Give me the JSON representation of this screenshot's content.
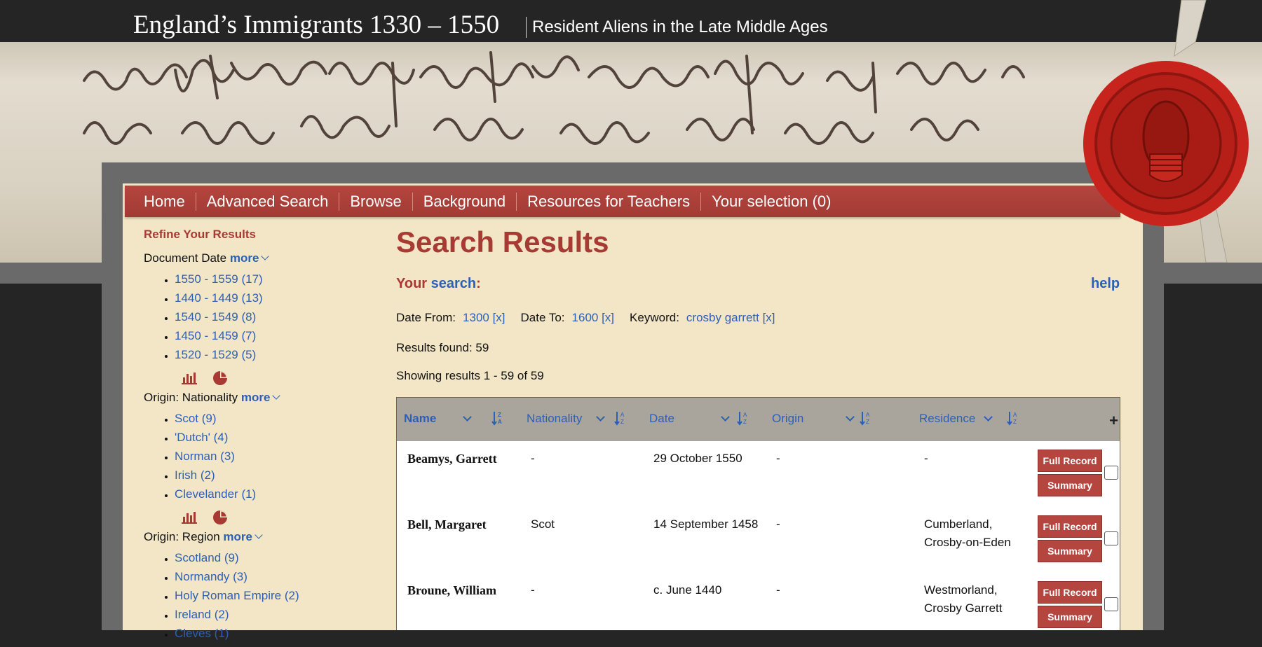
{
  "header": {
    "title": "England’s Immigrants 1330 – 1550",
    "subtitle": "Resident Aliens in the Late Middle Ages"
  },
  "nav": [
    "Home",
    "Advanced Search",
    "Browse",
    "Background",
    "Resources for Teachers",
    "Your selection (0)"
  ],
  "sidebar": {
    "heading": "Refine Your Results",
    "more_label": "more",
    "facets": [
      {
        "label": "Document Date",
        "items": [
          "1550 - 1559 (17)",
          "1440 - 1449 (13)",
          "1540 - 1549 (8)",
          "1450 - 1459 (7)",
          "1520 - 1529 (5)"
        ]
      },
      {
        "label": "Origin: Nationality",
        "items": [
          "Scot (9)",
          "'Dutch' (4)",
          "Norman (3)",
          "Irish (2)",
          "Clevelander (1)"
        ]
      },
      {
        "label": "Origin: Region",
        "items": [
          "Scotland (9)",
          "Normandy (3)",
          "Holy Roman Empire (2)",
          "Ireland (2)",
          "Cleves (1)"
        ]
      }
    ]
  },
  "main": {
    "title": "Search Results",
    "your": "Your",
    "search_link": "search",
    "colon": ":",
    "help": "help",
    "criteria": [
      {
        "label": "Date From:",
        "value": "1300 [x]"
      },
      {
        "label": "Date To:",
        "value": "1600 [x]"
      },
      {
        "label": "Keyword:",
        "value": "crosby garrett [x]"
      }
    ],
    "results_found": "Results found: 59",
    "showing": "Showing results 1 - 59 of 59"
  },
  "table": {
    "columns": [
      "Name",
      "Nationality",
      "Date",
      "Origin",
      "Residence"
    ],
    "full_record_label": "Full Record",
    "summary_label": "Summary",
    "rows": [
      {
        "name": "Beamys, Garrett",
        "nationality": "-",
        "date": "29 October 1550",
        "origin": "-",
        "residence": [
          "-"
        ]
      },
      {
        "name": "Bell, Margaret",
        "nationality": "Scot",
        "date": "14 September 1458",
        "origin": "-",
        "residence": [
          "Cumberland,",
          "Crosby-on-Eden"
        ]
      },
      {
        "name": "Broune, William",
        "nationality": "-",
        "date": "c. June 1440",
        "origin": "-",
        "residence": [
          "Westmorland,",
          "Crosby Garrett"
        ]
      }
    ]
  },
  "colors": {
    "accent": "#b4463f",
    "link": "#2c5fb6",
    "panel": "#f2e6c6"
  },
  "icons": [
    "bar-chart-icon",
    "pie-chart-icon",
    "sort-icon",
    "plus-icon",
    "wax-seal-icon"
  ]
}
